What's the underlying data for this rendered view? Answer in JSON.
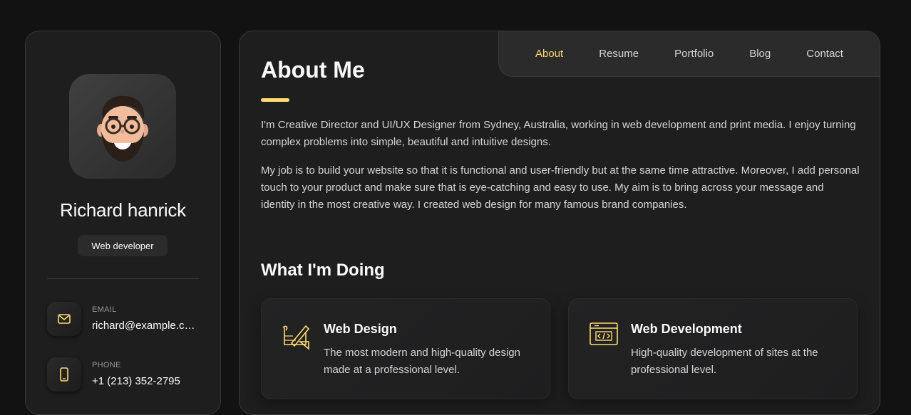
{
  "sidebar": {
    "name": "Richard hanrick",
    "role": "Web developer",
    "contacts": [
      {
        "label": "EMAIL",
        "value": "richard@example.com",
        "icon": "mail-icon"
      },
      {
        "label": "PHONE",
        "value": "+1 (213) 352-2795",
        "icon": "phone-icon"
      }
    ]
  },
  "nav": {
    "items": [
      "About",
      "Resume",
      "Portfolio",
      "Blog",
      "Contact"
    ],
    "active": "About"
  },
  "about": {
    "title": "About Me",
    "paragraphs": [
      "I'm Creative Director and UI/UX Designer from Sydney, Australia, working in web development and print media. I enjoy turning complex problems into simple, beautiful and intuitive designs.",
      "My job is to build your website so that it is functional and user-friendly but at the same time attractive. Moreover, I add personal touch to your product and make sure that is eye-catching and easy to use. My aim is to bring across your message and identity in the most creative way. I created web design for many famous brand companies."
    ]
  },
  "doing": {
    "title": "What I'm Doing",
    "services": [
      {
        "title": "Web Design",
        "text": "The most modern and high-quality design made at a professional level.",
        "icon": "design-icon"
      },
      {
        "title": "Web Development",
        "text": "High-quality development of sites at the professional level.",
        "icon": "dev-icon"
      }
    ]
  },
  "colors": {
    "accent": "#ffdb70",
    "background": "#121212",
    "card": "#1e1e1f"
  }
}
